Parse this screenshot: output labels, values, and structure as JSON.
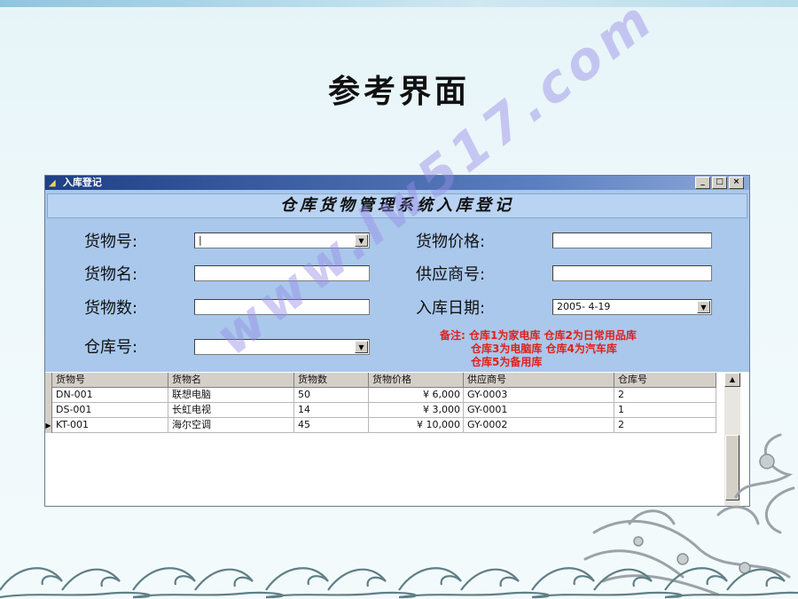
{
  "slide": {
    "title": "参考界面"
  },
  "window": {
    "title": "入库登记",
    "banner": "仓库货物管理系统入库登记",
    "controls": {
      "minimize": "_",
      "maximize": "□",
      "close": "×"
    }
  },
  "form": {
    "item_no_label": "货物号:",
    "item_no_value": "|",
    "item_price_label": "货物价格:",
    "item_price_value": "",
    "item_name_label": "货物名:",
    "item_name_value": "",
    "supplier_no_label": "供应商号:",
    "supplier_no_value": "",
    "item_qty_label": "货物数:",
    "item_qty_value": "",
    "in_date_label": "入库日期:",
    "in_date_value": "2005- 4-19",
    "warehouse_label": "仓库号:",
    "warehouse_value": "",
    "note_line1": "备注: 仓库1为家电库 仓库2为日常用品库",
    "note_line2": "仓库3为电脑库 仓库4为汽车库",
    "note_line3": "仓库5为备用库"
  },
  "grid": {
    "columns": [
      "货物号",
      "货物名",
      "货物数",
      "货物价格",
      "供应商号",
      "仓库号"
    ],
    "rows": [
      [
        "DN-001",
        "联想电脑",
        "50",
        "¥ 6,000",
        "GY-0003",
        "2"
      ],
      [
        "DS-001",
        "长虹电视",
        "14",
        "¥ 3,000",
        "GY-0001",
        "1"
      ],
      [
        "KT-001",
        "海尔空调",
        "45",
        "¥ 10,000",
        "GY-0002",
        "2"
      ]
    ]
  },
  "watermark": "www.lw517.com",
  "colors": {
    "form_bg": "#a9c8ec",
    "titlebar": "#1f3f86",
    "note_red": "#e0201a"
  },
  "icons": [
    "app-icon",
    "dropdown-arrow-icon",
    "scroll-up-icon",
    "row-pointer-icon"
  ]
}
